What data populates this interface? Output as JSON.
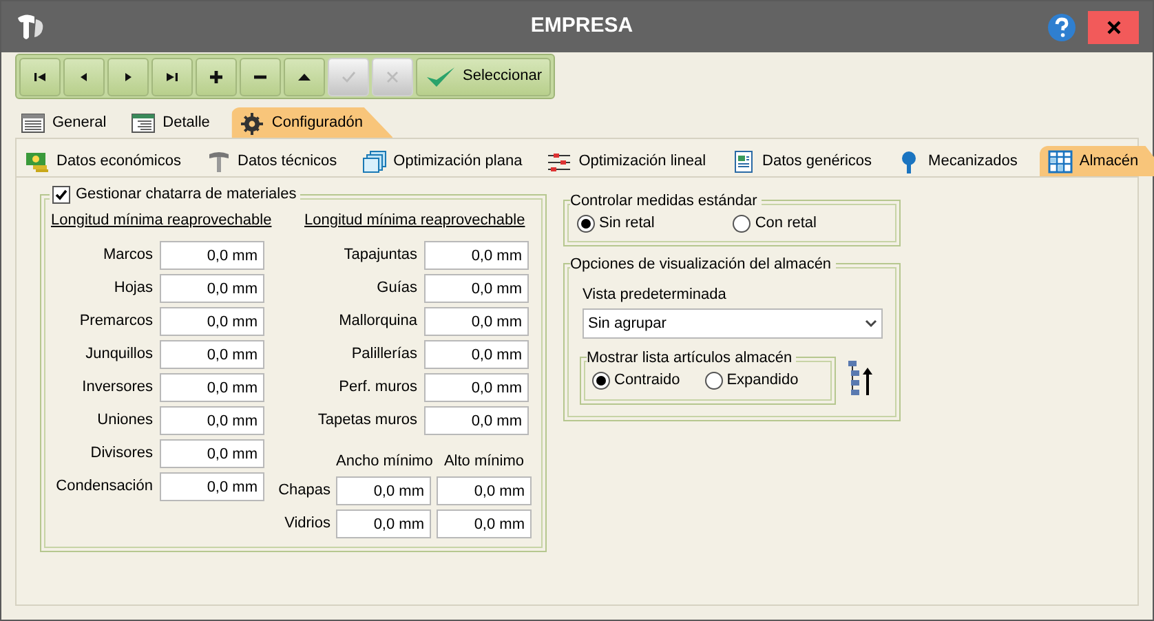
{
  "window": {
    "title": "EMPRESA"
  },
  "toolbar": {
    "buttons": [
      {
        "kind": "first",
        "disabled": false
      },
      {
        "kind": "prev",
        "disabled": false
      },
      {
        "kind": "next",
        "disabled": false
      },
      {
        "kind": "last",
        "disabled": false
      },
      {
        "kind": "add",
        "disabled": false
      },
      {
        "kind": "remove",
        "disabled": false
      },
      {
        "kind": "up",
        "disabled": false
      },
      {
        "kind": "accept",
        "disabled": true
      },
      {
        "kind": "cancel",
        "disabled": true
      },
      {
        "kind": "select",
        "label": "Seleccionar",
        "disabled": false
      }
    ]
  },
  "tabs": [
    {
      "label": "General",
      "selected": false
    },
    {
      "label": "Detalle",
      "selected": false
    },
    {
      "label": "Configuradón",
      "selected": true
    }
  ],
  "subtabs": [
    {
      "label": "Datos económicos",
      "selected": false
    },
    {
      "label": "Datos técnicos",
      "selected": false
    },
    {
      "label": "Optimización plana",
      "selected": false
    },
    {
      "label": "Optimización lineal",
      "selected": false
    },
    {
      "label": "Datos genéricos",
      "selected": false
    },
    {
      "label": "Mecanizados",
      "selected": false
    },
    {
      "label": "Almacén",
      "selected": true
    }
  ],
  "scrap_group": {
    "label": "Gestionar chatarra de materiales",
    "checked": true,
    "columns": [
      {
        "heading": "Longitud mínima reaprovechable",
        "fields": [
          {
            "label": "Marcos",
            "value": "0,0 mm"
          },
          {
            "label": "Hojas",
            "value": "0,0 mm"
          },
          {
            "label": "Premarcos",
            "value": "0,0 mm"
          },
          {
            "label": "Junquillos",
            "value": "0,0 mm"
          },
          {
            "label": "Inversores",
            "value": "0,0 mm"
          },
          {
            "label": "Uniones",
            "value": "0,0 mm"
          },
          {
            "label": "Divisores",
            "value": "0,0 mm"
          },
          {
            "label": "Condensación",
            "value": "0,0 mm"
          }
        ]
      },
      {
        "heading": "Longitud mínima reaprovechable",
        "fields": [
          {
            "label": "Tapajuntas",
            "value": "0,0 mm"
          },
          {
            "label": "Guías",
            "value": "0,0 mm"
          },
          {
            "label": "Mallorquina",
            "value": "0,0 mm"
          },
          {
            "label": "Palillerías",
            "value": "0,0 mm"
          },
          {
            "label": "Perf. muros",
            "value": "0,0 mm"
          },
          {
            "label": "Tapetas muros",
            "value": "0,0 mm"
          }
        ]
      }
    ],
    "dimensions": {
      "headings": [
        "Ancho mínimo",
        "Alto mínimo"
      ],
      "rows": [
        {
          "label": "Chapas",
          "values": [
            "0,0 mm",
            "0,0 mm"
          ]
        },
        {
          "label": "Vidrios",
          "values": [
            "0,0 mm",
            "0,0 mm"
          ]
        }
      ]
    }
  },
  "standard_group": {
    "title": "Controlar medidas estándar",
    "options": [
      {
        "label": "Sin retal",
        "selected": true
      },
      {
        "label": "Con retal",
        "selected": false
      }
    ]
  },
  "view_group": {
    "title": "Opciones de visualización del almacén",
    "dropdown": {
      "label": "Vista predeterminada",
      "value": "Sin agrupar"
    },
    "list_group": {
      "title": "Mostrar lista artículos almacén",
      "options": [
        {
          "label": "Contraido",
          "selected": true
        },
        {
          "label": "Expandido",
          "selected": false
        }
      ]
    }
  }
}
